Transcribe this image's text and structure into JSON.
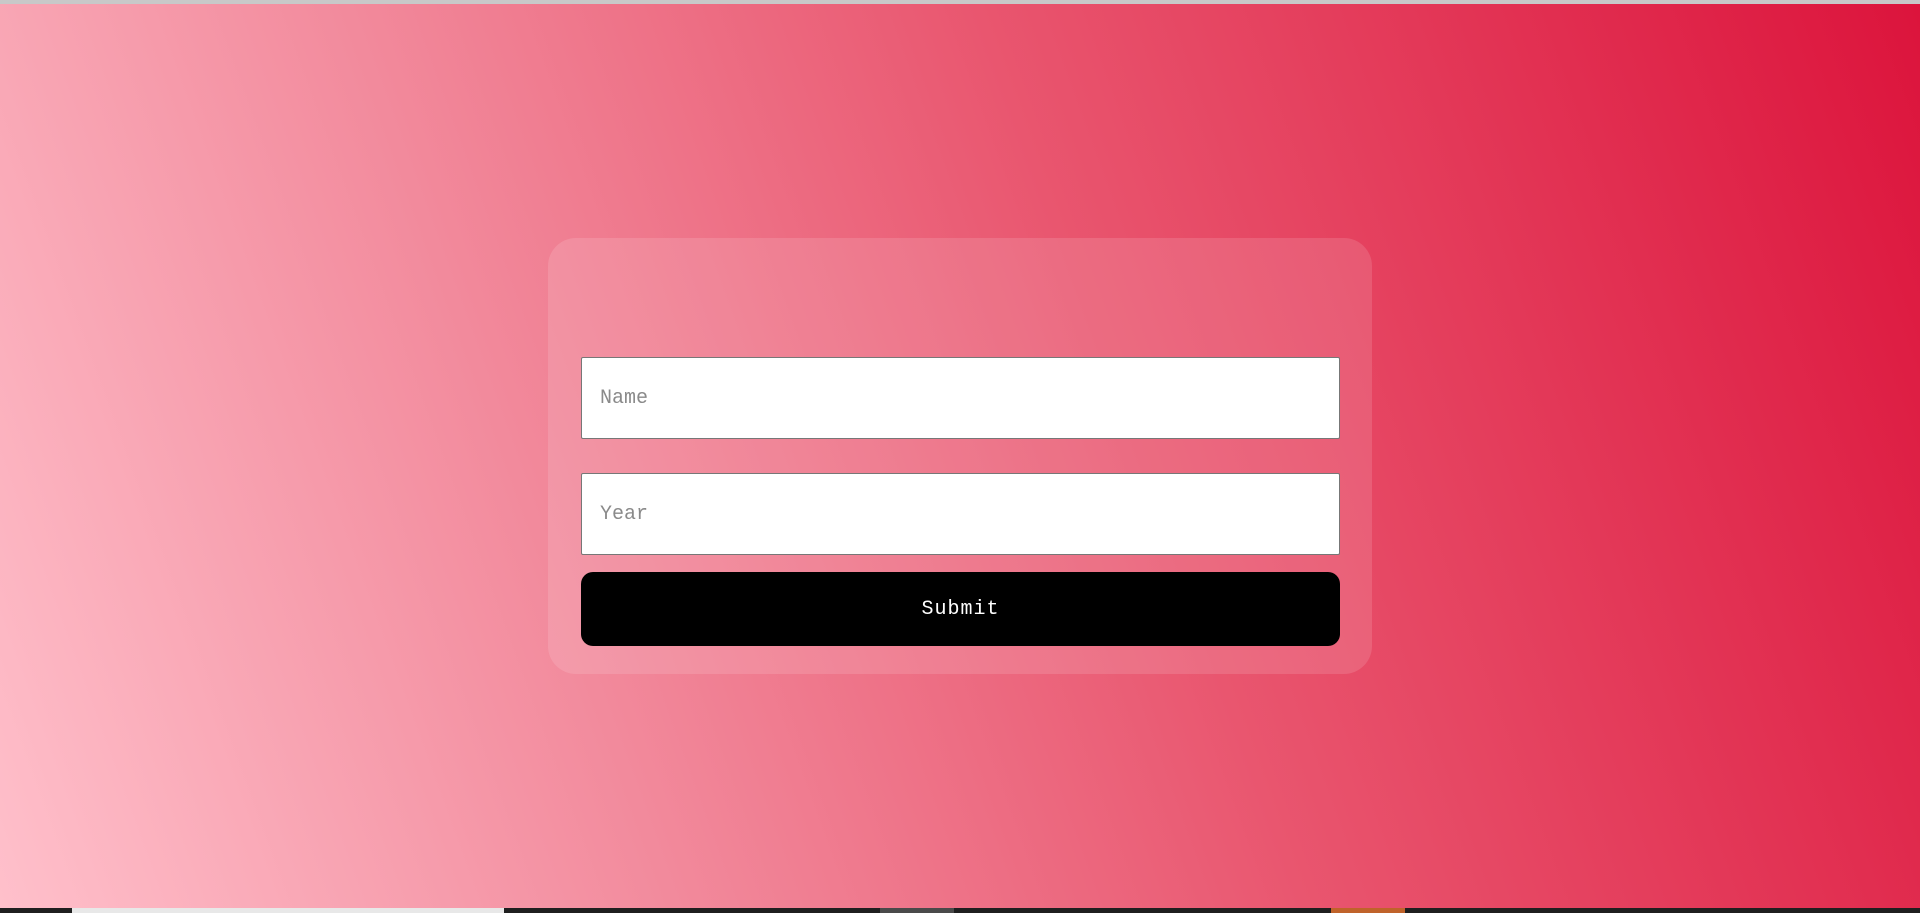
{
  "form": {
    "name_placeholder": "Name",
    "name_value": "",
    "year_placeholder": "Year",
    "year_value": "",
    "submit_label": "Submit"
  },
  "colors": {
    "gradient_start": "#ffc0cb",
    "gradient_end": "#dc143c",
    "button_background": "#000000",
    "button_text": "#ffffff"
  }
}
